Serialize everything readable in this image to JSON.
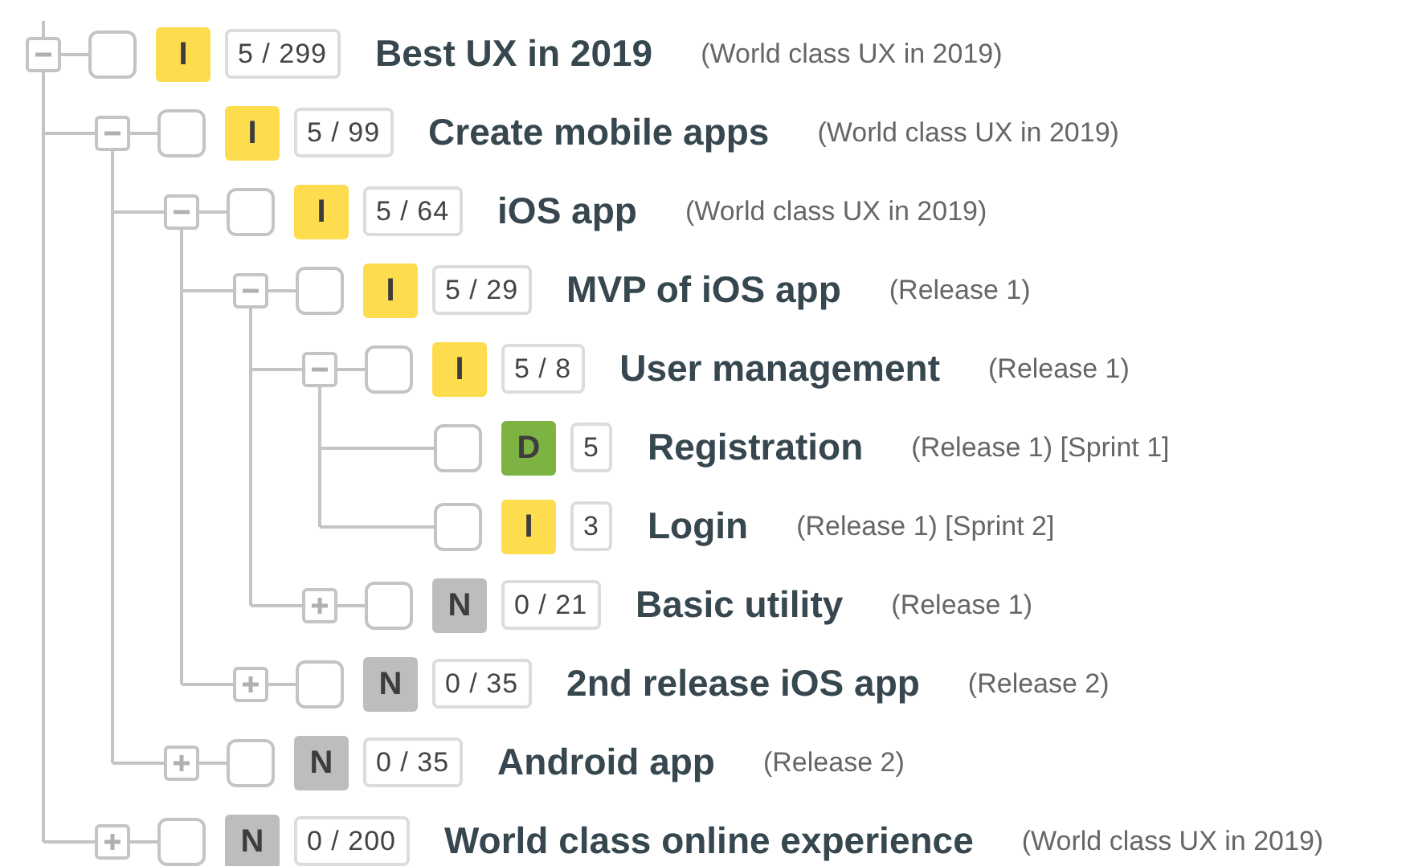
{
  "tree": [
    {
      "title": "Best UX in 2019",
      "note": "(World class UX in 2019)",
      "checked": false,
      "expanded": true,
      "status": {
        "letter": "I",
        "color": "#fddc4e"
      },
      "count": "5 / 299",
      "children": [
        {
          "title": "Create mobile apps",
          "note": "(World class UX in 2019)",
          "checked": false,
          "expanded": true,
          "status": {
            "letter": "I",
            "color": "#fddc4e"
          },
          "count": "5 / 99",
          "children": [
            {
              "title": "iOS app",
              "note": "(World class UX in 2019)",
              "checked": false,
              "expanded": true,
              "status": {
                "letter": "I",
                "color": "#fddc4e"
              },
              "count": "5 / 64",
              "children": [
                {
                  "title": "MVP of iOS app",
                  "note": "(Release 1)",
                  "checked": false,
                  "expanded": true,
                  "status": {
                    "letter": "I",
                    "color": "#fddc4e"
                  },
                  "count": "5 / 29",
                  "children": [
                    {
                      "title": "User management",
                      "note": "(Release 1)",
                      "checked": false,
                      "expanded": true,
                      "status": {
                        "letter": "I",
                        "color": "#fddc4e"
                      },
                      "count": "5 / 8",
                      "children": [
                        {
                          "title": "Registration",
                          "note": "(Release 1) [Sprint 1]",
                          "checked": false,
                          "status": {
                            "letter": "D",
                            "color": "#7cb342"
                          },
                          "count": "5"
                        },
                        {
                          "title": "Login",
                          "note": "(Release 1) [Sprint 2]",
                          "checked": false,
                          "status": {
                            "letter": "I",
                            "color": "#fddc4e"
                          },
                          "count": "3"
                        }
                      ]
                    },
                    {
                      "title": "Basic utility",
                      "note": "(Release 1)",
                      "checked": false,
                      "expanded": false,
                      "status": {
                        "letter": "N",
                        "color": "#bdbdbd"
                      },
                      "count": "0 / 21"
                    }
                  ]
                },
                {
                  "title": "2nd release iOS app",
                  "note": "(Release 2)",
                  "checked": false,
                  "expanded": false,
                  "status": {
                    "letter": "N",
                    "color": "#bdbdbd"
                  },
                  "count": "0 / 35"
                }
              ]
            },
            {
              "title": "Android app",
              "note": "(Release 2)",
              "checked": false,
              "expanded": false,
              "status": {
                "letter": "N",
                "color": "#bdbdbd"
              },
              "count": "0 / 35"
            }
          ]
        },
        {
          "title": "World class online experience",
          "note": "(World class UX in 2019)",
          "checked": false,
          "expanded": false,
          "status": {
            "letter": "N",
            "color": "#bdbdbd"
          },
          "count": "0 / 200"
        }
      ]
    }
  ]
}
